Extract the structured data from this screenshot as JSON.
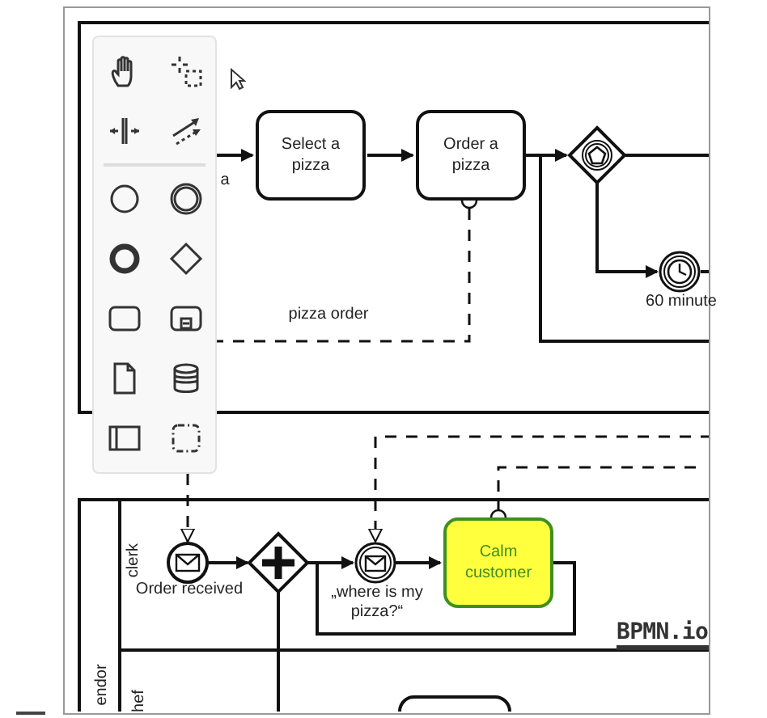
{
  "palette": {
    "tools": [
      {
        "kind": "hand"
      },
      {
        "kind": "lasso"
      },
      {
        "kind": "space"
      },
      {
        "kind": "connect"
      },
      {
        "kind": "start-event"
      },
      {
        "kind": "intermediate-event"
      },
      {
        "kind": "end-event"
      },
      {
        "kind": "gateway"
      },
      {
        "kind": "task"
      },
      {
        "kind": "subprocess"
      },
      {
        "kind": "data-object"
      },
      {
        "kind": "data-store"
      },
      {
        "kind": "pool"
      },
      {
        "kind": "group"
      }
    ]
  },
  "diagram": {
    "flow_label": "a",
    "tasks": [
      {
        "text": "Select a pizza",
        "highlighted": false
      },
      {
        "text": "Order a pizza",
        "highlighted": false
      },
      {
        "text": "Calm customer",
        "highlighted": true
      }
    ],
    "message_label": "pizza order",
    "timer_label": "60 minute",
    "pool_label": "endor",
    "lanes": [
      "clerk",
      "hef"
    ],
    "start_label": "Order received",
    "catch_label": "„where is my pizza?“"
  },
  "logo": "BPMN.io"
}
